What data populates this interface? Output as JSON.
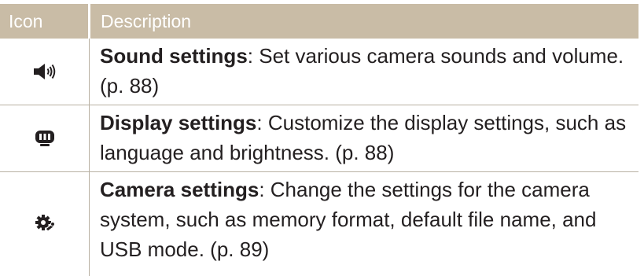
{
  "header": {
    "col1": "Icon",
    "col2": "Description"
  },
  "rows": [
    {
      "icon": "sound-icon",
      "title": "Sound settings",
      "text": ": Set various camera sounds and volume. (p. 88)"
    },
    {
      "icon": "display-icon",
      "title": "Display settings",
      "text": ": Customize the display settings, such as language and brightness. (p. 88)"
    },
    {
      "icon": "camera-settings-icon",
      "title": "Camera settings",
      "text": ": Change the settings for the camera system, such as memory format, default file name, and USB mode. (p. 89)"
    }
  ],
  "colors": {
    "header_bg": "#c9bca6",
    "rule": "#b8b0a2",
    "text": "#231f20"
  }
}
